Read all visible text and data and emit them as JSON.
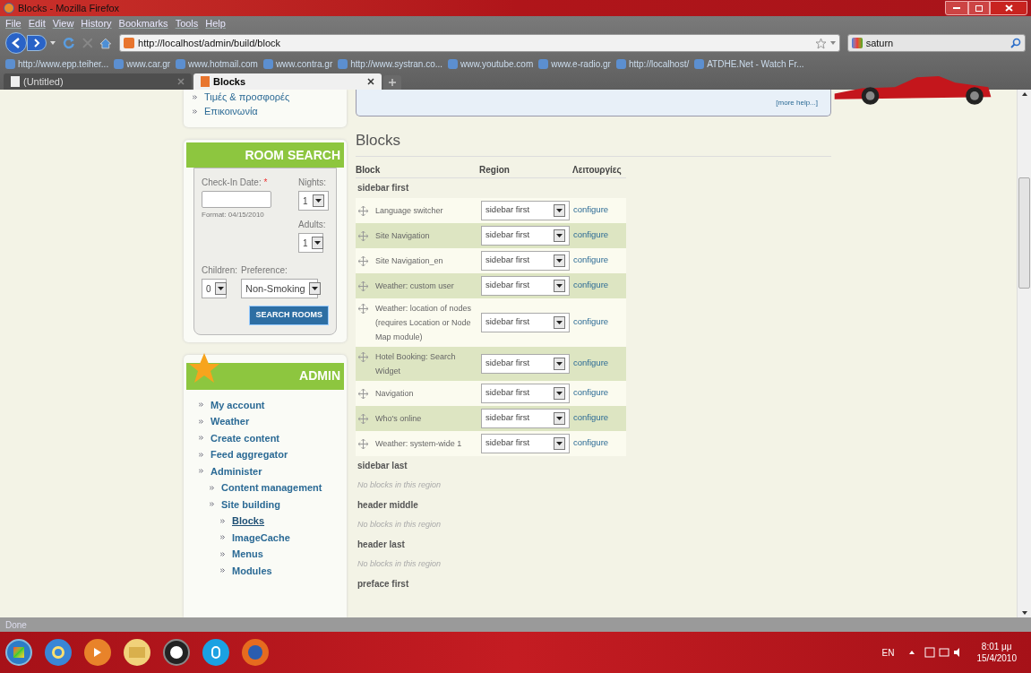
{
  "window": {
    "title": "Blocks - Mozilla Firefox"
  },
  "menu": [
    "File",
    "Edit",
    "View",
    "History",
    "Bookmarks",
    "Tools",
    "Help"
  ],
  "address": {
    "url": "http://localhost/admin/build/block"
  },
  "search": {
    "value": "saturn"
  },
  "bookmarks": [
    "http://www.epp.teiher...",
    "www.car.gr",
    "www.hotmail.com",
    "www.contra.gr",
    "http://www.systran.co...",
    "www.youtube.com",
    "www.e-radio.gr",
    "http://localhost/",
    "ATDHE.Net - Watch Fr..."
  ],
  "tabs": [
    {
      "label": "(Untitled)",
      "selected": false
    },
    {
      "label": "Blocks",
      "selected": true
    }
  ],
  "sidebar": {
    "top_links": [
      "Τιμές & προσφορές",
      "Επικοινωνία"
    ],
    "room_search": {
      "title": "ROOM SEARCH",
      "checkin_label": "Check-In Date:",
      "required_mark": "*",
      "checkin_hint": "Format: 04/15/2010",
      "nights_label": "Nights:",
      "nights": "1",
      "adults_label": "Adults:",
      "adults": "1",
      "children_label": "Children:",
      "children": "0",
      "preference_label": "Preference:",
      "preference": "Non-Smoking",
      "button": "SEARCH ROOMS"
    },
    "admin": {
      "title": "ADMIN",
      "items": [
        {
          "label": "My account",
          "selected": false
        },
        {
          "label": "Weather",
          "selected": false
        },
        {
          "label": "Create content",
          "selected": false
        },
        {
          "label": "Feed aggregator",
          "selected": false
        },
        {
          "label": "Administer",
          "selected": false,
          "children": [
            {
              "label": "Content management",
              "selected": false
            },
            {
              "label": "Site building",
              "selected": false,
              "children": [
                {
                  "label": "Blocks",
                  "selected": true
                },
                {
                  "label": "ImageCache",
                  "selected": false
                },
                {
                  "label": "Menus",
                  "selected": false
                },
                {
                  "label": "Modules",
                  "selected": false
                }
              ]
            }
          ]
        }
      ]
    }
  },
  "main": {
    "help_link": "[more help...]",
    "heading": "Blocks",
    "columns": [
      "Block",
      "Region",
      "Λειτουργίες"
    ],
    "regions": [
      {
        "name": "sidebar first",
        "blocks": [
          {
            "name": "Language switcher",
            "region": "sidebar first",
            "action": "configure"
          },
          {
            "name": "Site Navigation",
            "region": "sidebar first",
            "action": "configure"
          },
          {
            "name": "Site Navigation_en",
            "region": "sidebar first",
            "action": "configure"
          },
          {
            "name": "Weather: custom user",
            "region": "sidebar first",
            "action": "configure"
          },
          {
            "name": "Weather: location of nodes (requires Location or Node Map module)",
            "region": "sidebar first",
            "action": "configure"
          },
          {
            "name": "Hotel Booking: Search Widget",
            "region": "sidebar first",
            "action": "configure"
          },
          {
            "name": "Navigation",
            "region": "sidebar first",
            "action": "configure"
          },
          {
            "name": "Who's online",
            "region": "sidebar first",
            "action": "configure"
          },
          {
            "name": "Weather: system-wide 1",
            "region": "sidebar first",
            "action": "configure"
          }
        ]
      },
      {
        "name": "sidebar last",
        "empty": "No blocks in this region"
      },
      {
        "name": "header middle",
        "empty": "No blocks in this region"
      },
      {
        "name": "header last",
        "empty": "No blocks in this region"
      },
      {
        "name": "preface first"
      }
    ]
  },
  "status_bar": "Done",
  "taskbar": {
    "language": "EN",
    "time": "8:01 μμ",
    "date": "15/4/2010"
  }
}
